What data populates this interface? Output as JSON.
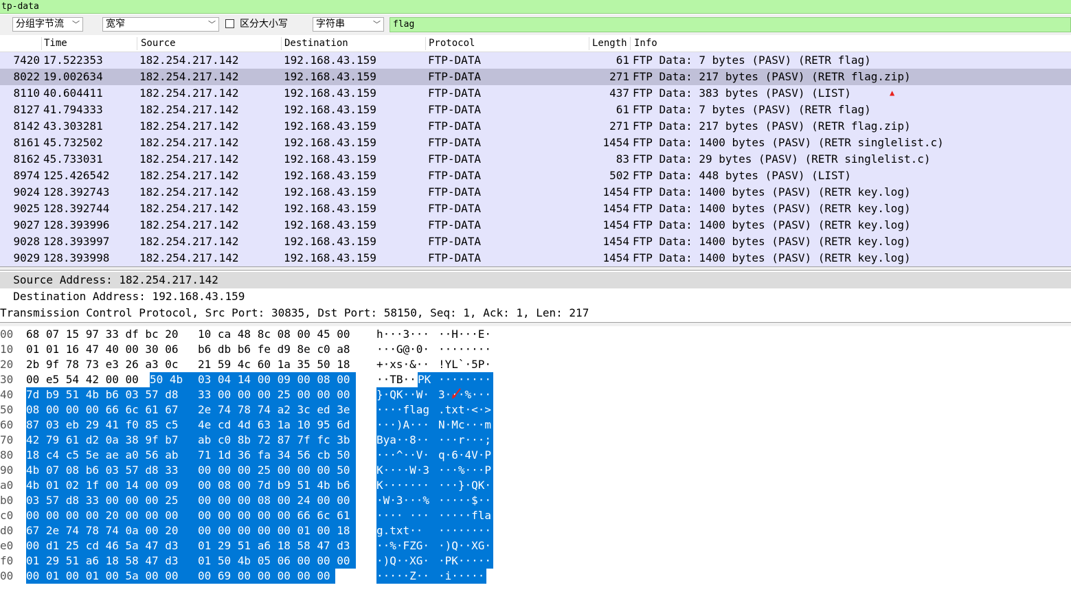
{
  "filter": {
    "text": "tp-data"
  },
  "toolbar": {
    "combo1": "分组字节流",
    "combo2": "宽窄",
    "case_label": "区分大小写",
    "combo3": "字符串",
    "search_value": "flag"
  },
  "columns": {
    "no": "",
    "time": "Time",
    "source": "Source",
    "destination": "Destination",
    "protocol": "Protocol",
    "length": "Length",
    "info": "Info"
  },
  "packets": [
    {
      "no": "7420",
      "time": "17.522353",
      "src": "182.254.217.142",
      "dst": "192.168.43.159",
      "proto": "FTP-DATA",
      "len": "61",
      "info": "FTP Data: 7 bytes (PASV) (RETR flag)"
    },
    {
      "no": "8022",
      "time": "19.002634",
      "src": "182.254.217.142",
      "dst": "192.168.43.159",
      "proto": "FTP-DATA",
      "len": "271",
      "info": "FTP Data: 217 bytes (PASV) (RETR flag.zip)"
    },
    {
      "no": "8110",
      "time": "40.604411",
      "src": "182.254.217.142",
      "dst": "192.168.43.159",
      "proto": "FTP-DATA",
      "len": "437",
      "info": "FTP Data: 383 bytes (PASV) (LIST)"
    },
    {
      "no": "8127",
      "time": "41.794333",
      "src": "182.254.217.142",
      "dst": "192.168.43.159",
      "proto": "FTP-DATA",
      "len": "61",
      "info": "FTP Data: 7 bytes (PASV) (RETR flag)"
    },
    {
      "no": "8142",
      "time": "43.303281",
      "src": "182.254.217.142",
      "dst": "192.168.43.159",
      "proto": "FTP-DATA",
      "len": "271",
      "info": "FTP Data: 217 bytes (PASV) (RETR flag.zip)"
    },
    {
      "no": "8161",
      "time": "45.732502",
      "src": "182.254.217.142",
      "dst": "192.168.43.159",
      "proto": "FTP-DATA",
      "len": "1454",
      "info": "FTP Data: 1400 bytes (PASV) (RETR singlelist.c)"
    },
    {
      "no": "8162",
      "time": "45.733031",
      "src": "182.254.217.142",
      "dst": "192.168.43.159",
      "proto": "FTP-DATA",
      "len": "83",
      "info": "FTP Data: 29 bytes (PASV) (RETR singlelist.c)"
    },
    {
      "no": "8974",
      "time": "125.426542",
      "src": "182.254.217.142",
      "dst": "192.168.43.159",
      "proto": "FTP-DATA",
      "len": "502",
      "info": "FTP Data: 448 bytes (PASV) (LIST)"
    },
    {
      "no": "9024",
      "time": "128.392743",
      "src": "182.254.217.142",
      "dst": "192.168.43.159",
      "proto": "FTP-DATA",
      "len": "1454",
      "info": "FTP Data: 1400 bytes (PASV) (RETR key.log)"
    },
    {
      "no": "9025",
      "time": "128.392744",
      "src": "182.254.217.142",
      "dst": "192.168.43.159",
      "proto": "FTP-DATA",
      "len": "1454",
      "info": "FTP Data: 1400 bytes (PASV) (RETR key.log)"
    },
    {
      "no": "9027",
      "time": "128.393996",
      "src": "182.254.217.142",
      "dst": "192.168.43.159",
      "proto": "FTP-DATA",
      "len": "1454",
      "info": "FTP Data: 1400 bytes (PASV) (RETR key.log)"
    },
    {
      "no": "9028",
      "time": "128.393997",
      "src": "182.254.217.142",
      "dst": "192.168.43.159",
      "proto": "FTP-DATA",
      "len": "1454",
      "info": "FTP Data: 1400 bytes (PASV) (RETR key.log)"
    },
    {
      "no": "9029",
      "time": "128.393998",
      "src": "182.254.217.142",
      "dst": "192.168.43.159",
      "proto": "FTP-DATA",
      "len": "1454",
      "info": "FTP Data: 1400 bytes (PASV) (RETR key.log)"
    }
  ],
  "details": {
    "src_addr": "  Source Address: 182.254.217.142",
    "dst_addr": "  Destination Address: 192.168.43.159",
    "tcp": "Transmission Control Protocol, Src Port: 30835, Dst Port: 58150, Seq: 1, Ack: 1, Len: 217"
  },
  "hexdump": [
    {
      "off": "00",
      "b1": "68 07 15 97 33 df bc 20",
      "b2": "10 ca 48 8c 08 00 45 00",
      "a1": "h···3···",
      "a2": "··H···E·"
    },
    {
      "off": "10",
      "b1": "01 01 16 47 40 00 30 06",
      "b2": "b6 db b6 fe d9 8e c0 a8",
      "a1": "···G@·0·",
      "a2": "········"
    },
    {
      "off": "20",
      "b1": "2b 9f 78 73 e3 26 a3 0c",
      "b2": "21 59 4c 60 1a 35 50 18",
      "a1": "+·xs·&··",
      "a2": "!YL`·5P·"
    },
    {
      "off": "30",
      "b1a": "00 e5 54 42 00 00 ",
      "b1b": "50 4b",
      "b2": "03 04 14 00 09 00 08 00",
      "a1a": "··TB··",
      "a1b": "PK",
      "a2": "········"
    },
    {
      "off": "40",
      "b1": "7d b9 51 4b b6 03 57 d8",
      "b2": "33 00 00 00 25 00 00 00",
      "a1": "}·QK··W·",
      "a2": "3···%···"
    },
    {
      "off": "50",
      "b1": "08 00 00 00 66 6c 61 67",
      "b2": "2e 74 78 74 a2 3c ed 3e",
      "a1": "····flag",
      "a2": ".txt·<·>"
    },
    {
      "off": "60",
      "b1": "87 03 eb 29 41 f0 85 c5",
      "b2": "4e cd 4d 63 1a 10 95 6d",
      "a1": "···)A···",
      "a2": "N·Mc···m"
    },
    {
      "off": "70",
      "b1": "42 79 61 d2 0a 38 9f b7",
      "b2": "ab c0 8b 72 87 7f fc 3b",
      "a1": "Bya··8··",
      "a2": "···r···;"
    },
    {
      "off": "80",
      "b1": "18 c4 c5 5e ae a0 56 ab",
      "b2": "71 1d 36 fa 34 56 cb 50",
      "a1": "···^··V·",
      "a2": "q·6·4V·P"
    },
    {
      "off": "90",
      "b1": "4b 07 08 b6 03 57 d8 33",
      "b2": "00 00 00 25 00 00 00 50",
      "a1": "K····W·3",
      "a2": "···%···P"
    },
    {
      "off": "a0",
      "b1": "4b 01 02 1f 00 14 00 09",
      "b2": "00 08 00 7d b9 51 4b b6",
      "a1": "K·······",
      "a2": "···}·QK·"
    },
    {
      "off": "b0",
      "b1": "03 57 d8 33 00 00 00 25",
      "b2": "00 00 00 08 00 24 00 00",
      "a1": "·W·3···%",
      "a2": "·····$··"
    },
    {
      "off": "c0",
      "b1": "00 00 00 00 20 00 00 00",
      "b2": "00 00 00 00 00 66 6c 61",
      "a1": "···· ···",
      "a2": "·····fla"
    },
    {
      "off": "d0",
      "b1": "67 2e 74 78 74 0a 00 20",
      "b2": "00 00 00 00 00 01 00 18",
      "a1": "g.txt·· ",
      "a2": "········"
    },
    {
      "off": "e0",
      "b1": "00 d1 25 cd 46 5a 47 d3",
      "b2": "01 29 51 a6 18 58 47 d3",
      "a1": "··%·FZG·",
      "a2": "·)Q··XG·"
    },
    {
      "off": "f0",
      "b1": "01 29 51 a6 18 58 47 d3",
      "b2": "01 50 4b 05 06 00 00 00",
      "a1": "·)Q··XG·",
      "a2": "·PK·····"
    },
    {
      "off": "00",
      "b1": "00 01 00 01 00 5a 00 00",
      "b2": "00 69 00 00 00 00 00",
      "a1": "·····Z··",
      "a2": "·i·····"
    }
  ],
  "colors": {
    "filter_bg": "#b7f6a6",
    "row_bg": "#e4e4fc",
    "selected_row": "#c0c0d8",
    "hex_selection": "#0078d7",
    "marker": "#e8231e"
  }
}
